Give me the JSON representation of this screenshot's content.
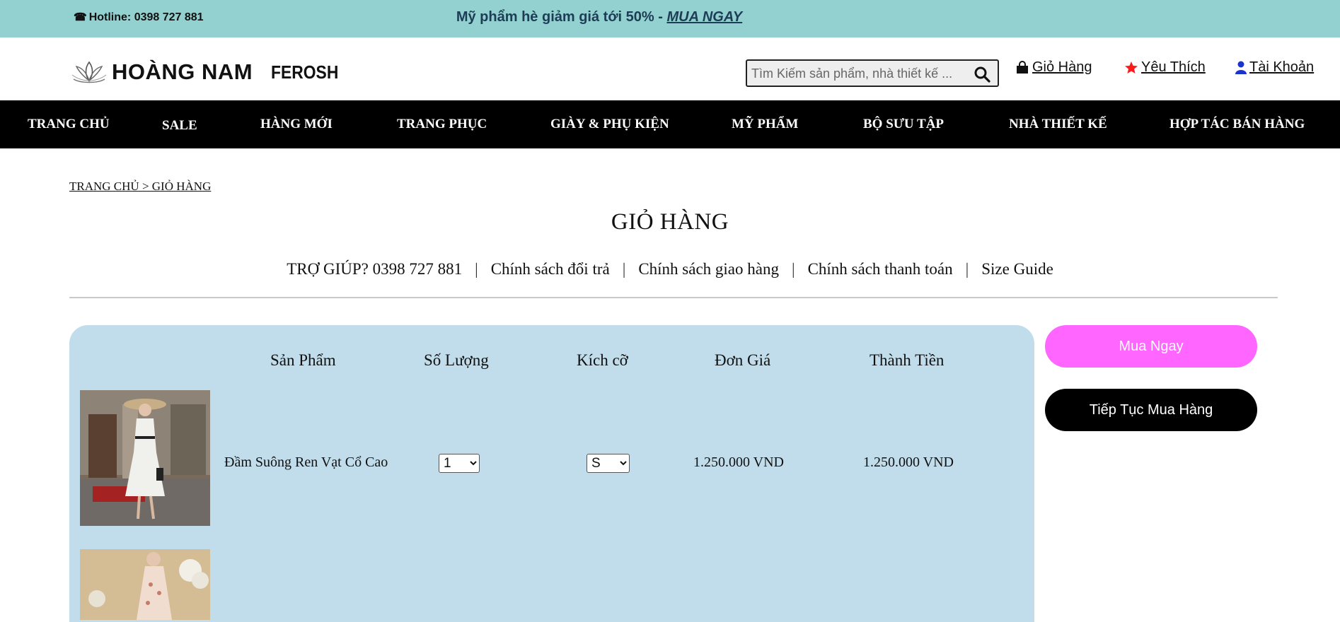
{
  "topbar": {
    "hotline_label": "Hotline:",
    "hotline_number": "0398 727 881",
    "promo_text": "Mỹ phẩm hè giảm giá tới 50% - ",
    "promo_link": "MUA NGAY",
    "background": "#93d1d0"
  },
  "header": {
    "brand_name": "HOÀNG NAM",
    "brand_sub": "FEROSH",
    "search_placeholder": "Tìm Kiếm sản phẩm, nhà thiết kế ...",
    "cart_link": "Giỏ Hàng",
    "favorites_link": "Yêu Thích",
    "account_link": "Tài Khoản",
    "icons": [
      "phone-icon",
      "search-icon",
      "shopping-bag-icon",
      "star-icon",
      "user-icon"
    ],
    "colors": {
      "favorite_star": "#ff1a1a",
      "account_icon": "#1a33cc"
    }
  },
  "nav": {
    "items": [
      "TRANG CHỦ",
      "SALE",
      "HÀNG MỚI",
      "TRANG PHỤC",
      "GIÀY & PHỤ KIỆN",
      "MỸ PHẨM",
      "BỘ SƯU TẬP",
      "NHÀ THIẾT KẾ",
      "HỢP TÁC BÁN HÀNG"
    ]
  },
  "breadcrumb": "TRANG CHỦ > GIỎ HÀNG",
  "page_title": "GIỎ HÀNG",
  "helpbar": {
    "help": "TRỢ GIÚP? 0398 727 881",
    "returns": "Chính sách đổi trả",
    "shipping": "Chính sách giao hàng",
    "payment": "Chính sách thanh toán",
    "size_guide": "Size Guide"
  },
  "cart": {
    "headers": {
      "product": "Sản Phẩm",
      "quantity": "Số Lượng",
      "size": "Kích cỡ",
      "unit_price": "Đơn Giá",
      "total": "Thành Tiền"
    },
    "items": [
      {
        "name": "Đầm Suông Ren Vạt Cổ Cao",
        "quantity": "1",
        "size": "S",
        "unit_price": "1.250.000 VND",
        "total": "1.250.000 VND"
      }
    ],
    "background": "#c1ddeb"
  },
  "actions": {
    "buy_now": "Mua Ngay",
    "continue_shopping": "Tiếp Tục Mua Hàng",
    "buy_color": "#ff66ff"
  }
}
